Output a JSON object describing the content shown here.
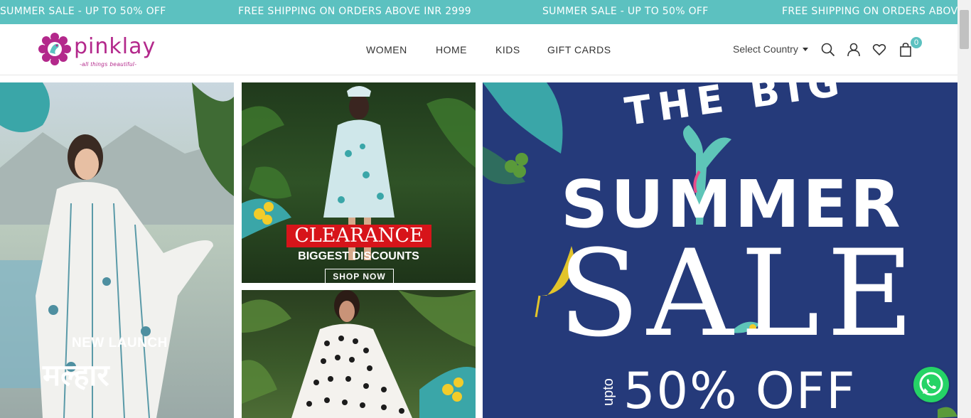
{
  "announcement": {
    "messages": [
      "SUMMER SALE - UP TO 50% OFF",
      "FREE SHIPPING ON ORDERS ABOVE INR 2999",
      "SUMMER SALE - UP TO 50% OFF",
      "FREE SHIPPING ON ORDERS ABOVE"
    ]
  },
  "brand": {
    "name": "pinklay",
    "tagline": "-all things beautiful-",
    "color": "#b3288b"
  },
  "nav": {
    "items": [
      "WOMEN",
      "HOME",
      "KIDS",
      "GIFT CARDS"
    ]
  },
  "header_tools": {
    "country_label": "Select Country",
    "cart_count": "0",
    "icons": [
      "search-icon",
      "user-icon",
      "heart-icon",
      "bag-icon"
    ]
  },
  "banners": {
    "new_launch": {
      "label": "NEW LAUNCH",
      "title": "मल्हार"
    },
    "clearance": {
      "title": "CLEARANCE",
      "subtitle": "BIGGEST DISCOUNTS",
      "cta": "SHOP NOW"
    },
    "summer_sale": {
      "line1": "THE BIG",
      "line2": "SUMMER",
      "line3": "SALE",
      "upto": "upto",
      "discount": "50% OFF",
      "bg_color": "#253a7a"
    }
  },
  "colors": {
    "accent": "#5cc1c0",
    "clearance_red": "#d7141a",
    "whatsapp": "#25d366"
  }
}
